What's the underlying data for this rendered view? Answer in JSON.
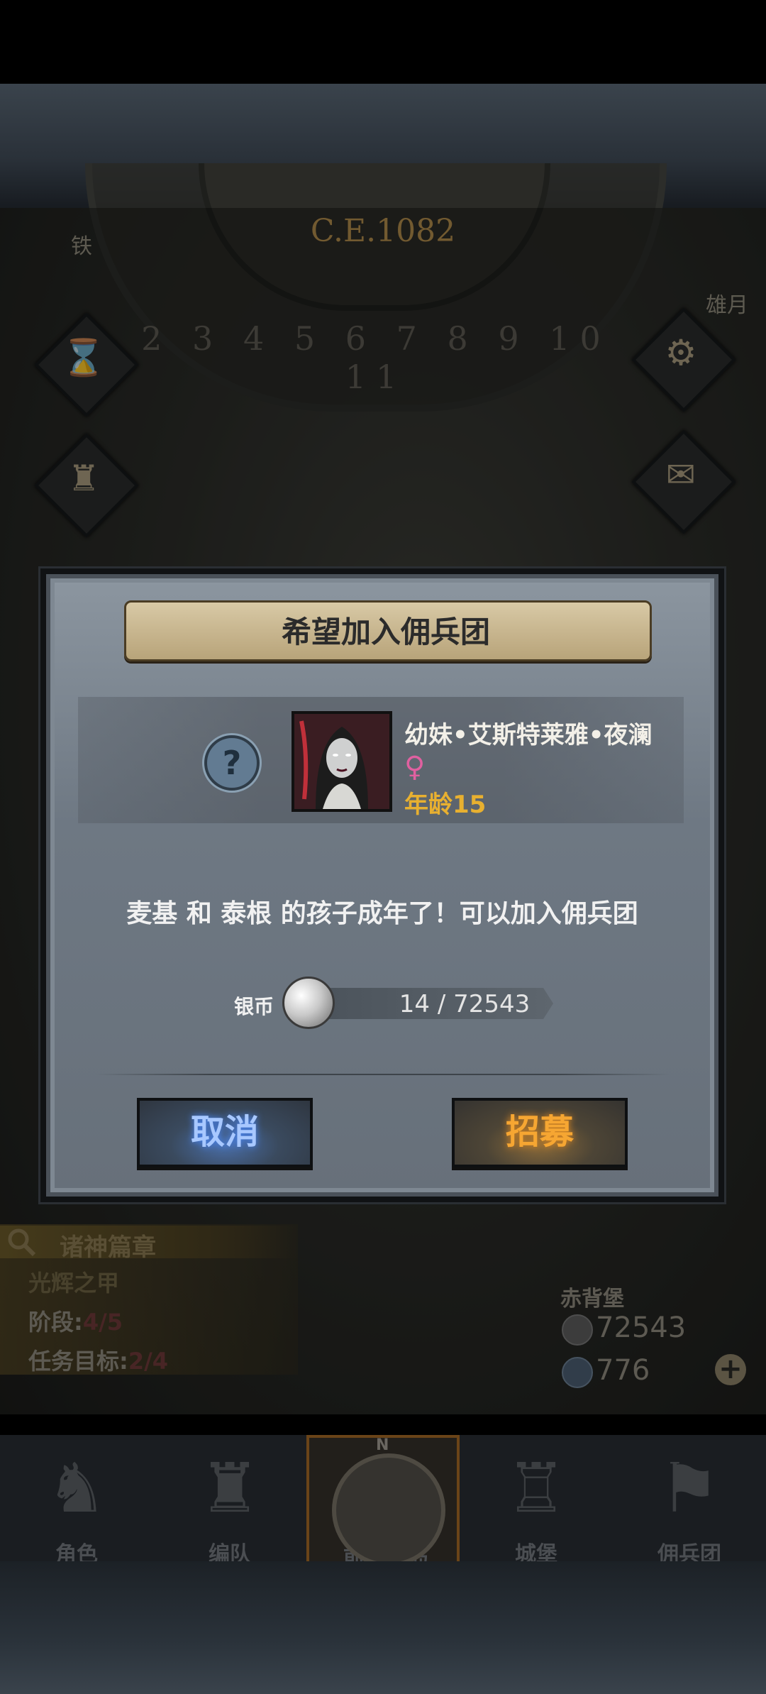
{
  "calendar": {
    "year": "C.E.1082",
    "month_numbers": "2 3 4 5 6 7 8 9 10 11"
  },
  "map": {
    "top_left_text": "铁",
    "top_right_text": "雄月"
  },
  "quest": {
    "title": "诸神篇章",
    "subtitle": "光辉之甲",
    "stage_label": "阶段:",
    "stage_value": "4/5",
    "goal_label": "任务目标:",
    "goal_value": "2/4"
  },
  "resources": {
    "castle_name": "赤背堡",
    "silver": "72543",
    "gems": "776",
    "plus": "+"
  },
  "nav": {
    "tabs": [
      {
        "label": "角色",
        "icon": "knight-helmet-icon"
      },
      {
        "label": "编队",
        "icon": "squad-helmet-icon"
      },
      {
        "label": "前往群岛",
        "icon": "compass-icon"
      },
      {
        "label": "城堡",
        "icon": "castle-icon"
      },
      {
        "label": "佣兵团",
        "icon": "mercenary-banner-icon"
      }
    ],
    "compass_north": "N"
  },
  "modal": {
    "title": "希望加入佣兵团",
    "character": {
      "name": "幼妹•艾斯特莱雅•夜澜",
      "gender_symbol": "♀",
      "age_label": "年龄",
      "age_value": "15"
    },
    "unknown_symbol": "?",
    "message": "麦基 和 泰根 的孩子成年了！可以加入佣兵团",
    "cost": {
      "label": "银币",
      "amount": "14 / 72543"
    },
    "buttons": {
      "cancel": "取消",
      "recruit": "招募"
    }
  },
  "colors": {
    "cancel_text": "#a8c8ff",
    "recruit_text": "#f6a632",
    "age_text": "#e8b030",
    "gender": "#e060a0"
  }
}
